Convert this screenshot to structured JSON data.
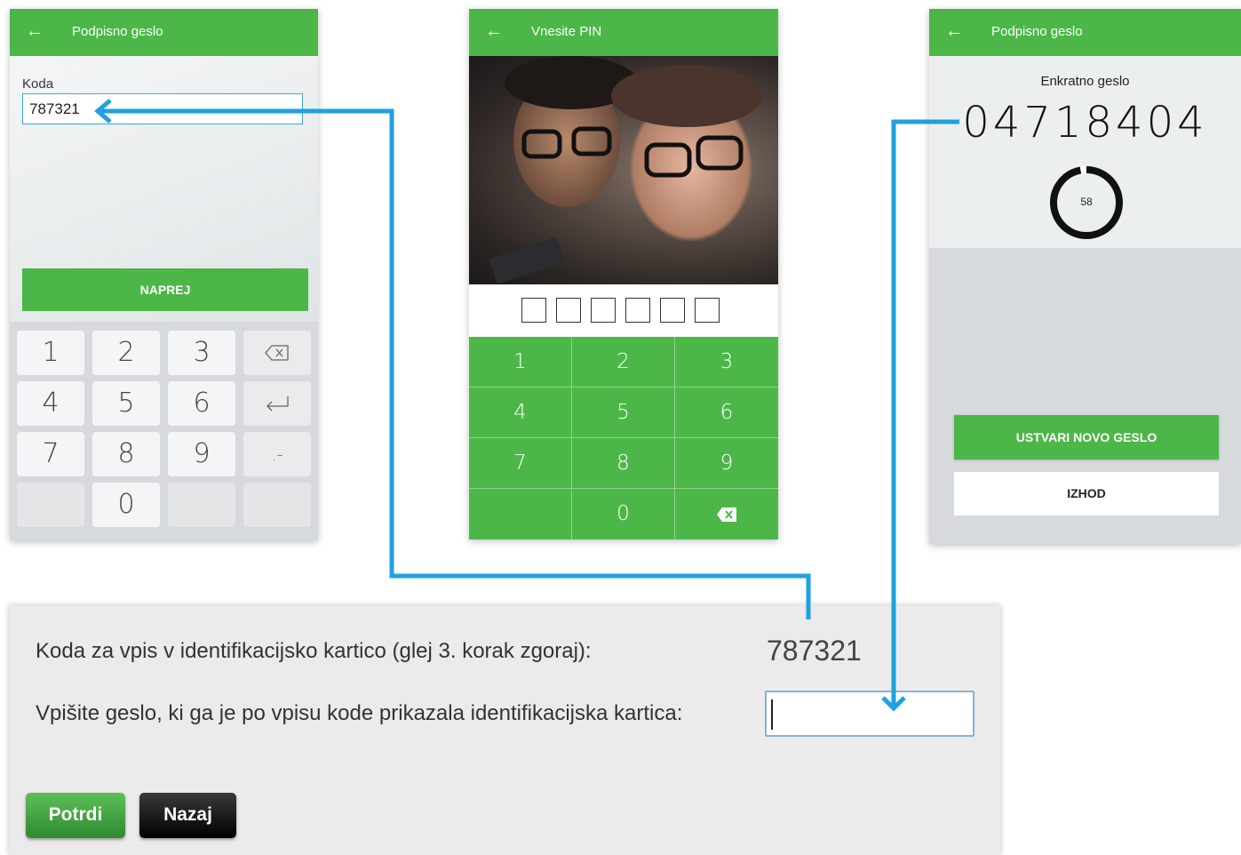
{
  "phone1": {
    "back_icon": "←",
    "title": "Podpisno geslo",
    "field_label": "Koda",
    "field_value": "787321",
    "next_button": "NAPREJ",
    "keys": [
      "1",
      "2",
      "3",
      "4",
      "5",
      "6",
      "7",
      "8",
      "9",
      "0"
    ],
    "dash_key": ".-"
  },
  "phone2": {
    "back_icon": "←",
    "title": "Vnesite PIN",
    "keys": [
      "1",
      "2",
      "3",
      "4",
      "5",
      "6",
      "7",
      "8",
      "9",
      "0"
    ]
  },
  "phone3": {
    "back_icon": "←",
    "title": "Podpisno geslo",
    "subtitle": "Enkratno geslo",
    "otp": "04718404",
    "countdown": "58",
    "countdown_fraction": 0.97,
    "create_button": "USTVARI NOVO GESLO",
    "exit_button": "IZHOD"
  },
  "form": {
    "code_label": "Koda za vpis v identifikacijsko kartico (glej 3. korak zgoraj):",
    "code_value": "787321",
    "password_label": "Vpišite geslo, ki ga je po vpisu kode prikazala identifikacijska kartica:",
    "password_value": "",
    "confirm_button": "Potrdi",
    "back_button": "Nazaj"
  },
  "colors": {
    "accent_green": "#4cb748",
    "connector_blue": "#1ea1e0"
  }
}
